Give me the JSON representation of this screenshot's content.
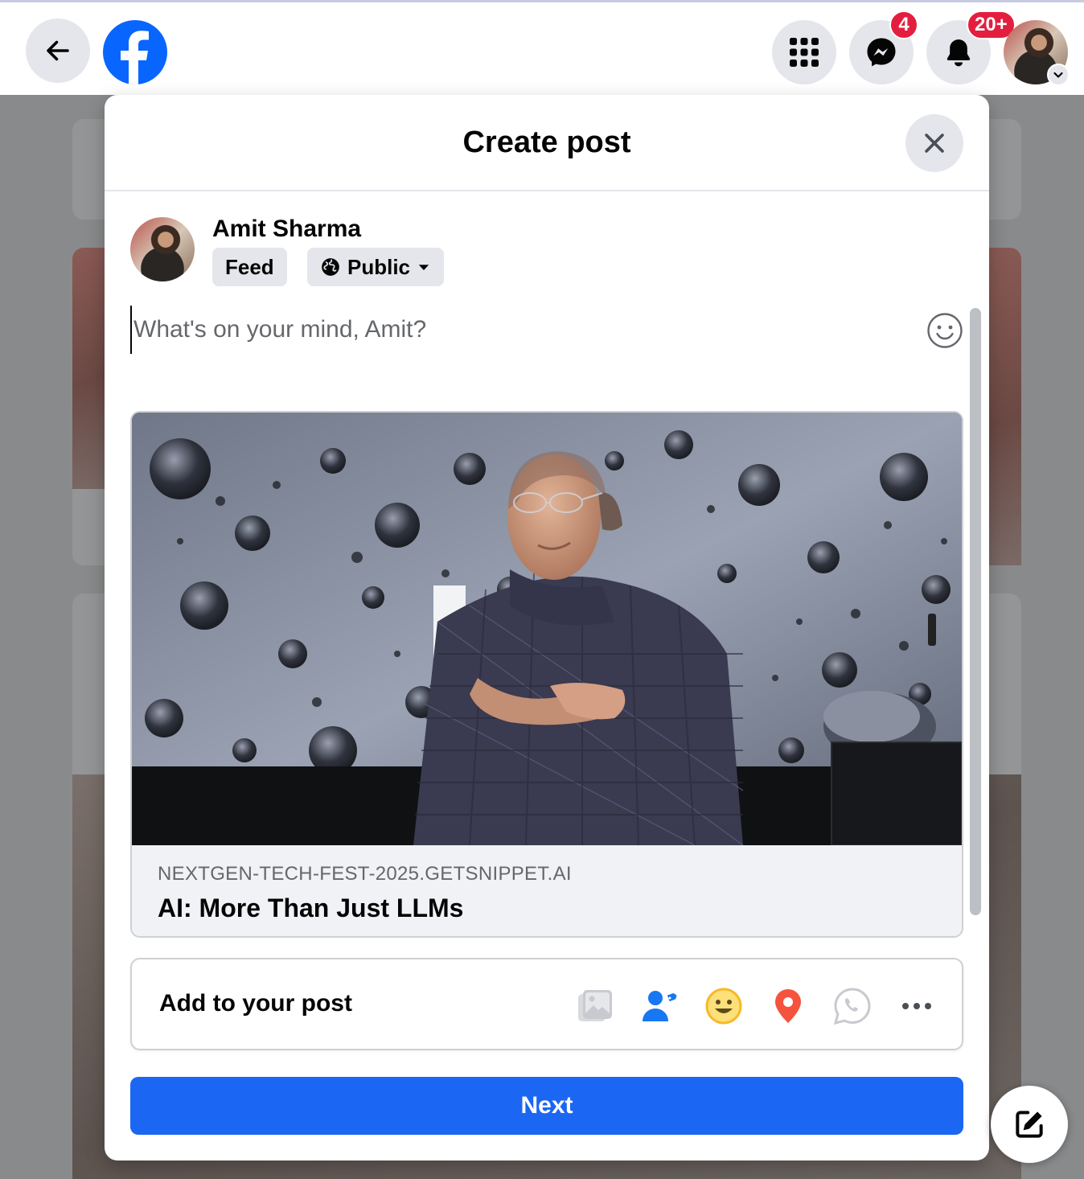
{
  "topbar": {
    "messenger_badge": "4",
    "notifications_badge": "20+"
  },
  "modal": {
    "title": "Create post",
    "author": {
      "name": "Amit Sharma",
      "audience_feed": "Feed",
      "audience_privacy": "Public"
    },
    "composer": {
      "placeholder": "What's on your mind, Amit?",
      "value": ""
    },
    "link_preview": {
      "domain": "NEXTGEN-TECH-FEST-2025.GETSNIPPET.AI",
      "title": "AI: More Than Just LLMs"
    },
    "add_to_post": {
      "label": "Add to your post",
      "icons": [
        "photo-video-icon",
        "tag-people-icon",
        "feeling-icon",
        "check-in-icon",
        "whatsapp-icon",
        "more-icon"
      ]
    },
    "next_label": "Next"
  },
  "colors": {
    "brand_blue": "#0866ff",
    "button_blue": "#1b67f3",
    "badge_red": "#e41e3f",
    "tag_blue": "#1877f2",
    "feeling_yellow": "#f7b928",
    "checkin_red": "#f5533d"
  }
}
